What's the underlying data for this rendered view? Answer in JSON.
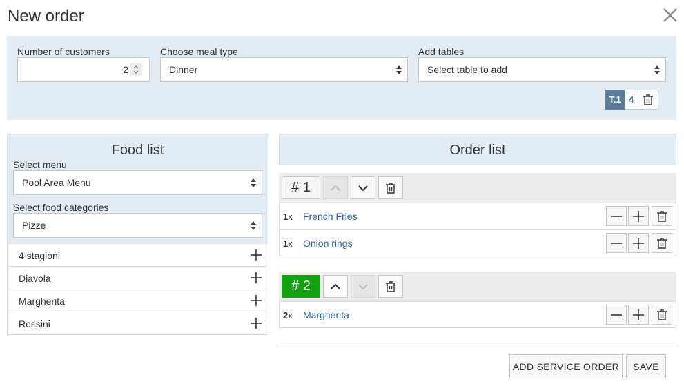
{
  "dialog": {
    "title": "New order"
  },
  "customers": {
    "label": "Number of customers",
    "value": "2"
  },
  "meal": {
    "label": "Choose meal type",
    "value": "Dinner"
  },
  "tables": {
    "label": "Add tables",
    "placeholder": "Select table to add",
    "selected": [
      {
        "name": "T.1",
        "count": "4"
      }
    ]
  },
  "food": {
    "title": "Food list",
    "menu_label": "Select menu",
    "menu_value": "Pool Area Menu",
    "category_label": "Select food categories",
    "category_value": "Pizze",
    "items": [
      "4 stagioni",
      "Diavola",
      "Margherita",
      "Rossini"
    ]
  },
  "order": {
    "title": "Order list",
    "groups": [
      {
        "label": "# 1",
        "items": [
          {
            "qty": "1",
            "x": "x",
            "name": "French Fries"
          },
          {
            "qty": "1",
            "x": "x",
            "name": "Onion rings"
          }
        ]
      },
      {
        "label": "# 2",
        "items": [
          {
            "qty": "2",
            "x": "x",
            "name": "Margherita"
          }
        ]
      }
    ]
  },
  "actions": {
    "add_service": "ADD SERVICE ORDER",
    "save": "SAVE"
  },
  "colors": {
    "panel": "#e3ebf3",
    "active_group": "#10a010",
    "link": "#2f62a4",
    "table_badge": "#5b7d9b"
  },
  "icons": {
    "close": "close-icon",
    "trash": "trash-icon",
    "plus": "plus-icon",
    "minus": "minus-icon",
    "up": "chevron-up-icon",
    "down": "chevron-down-icon"
  }
}
